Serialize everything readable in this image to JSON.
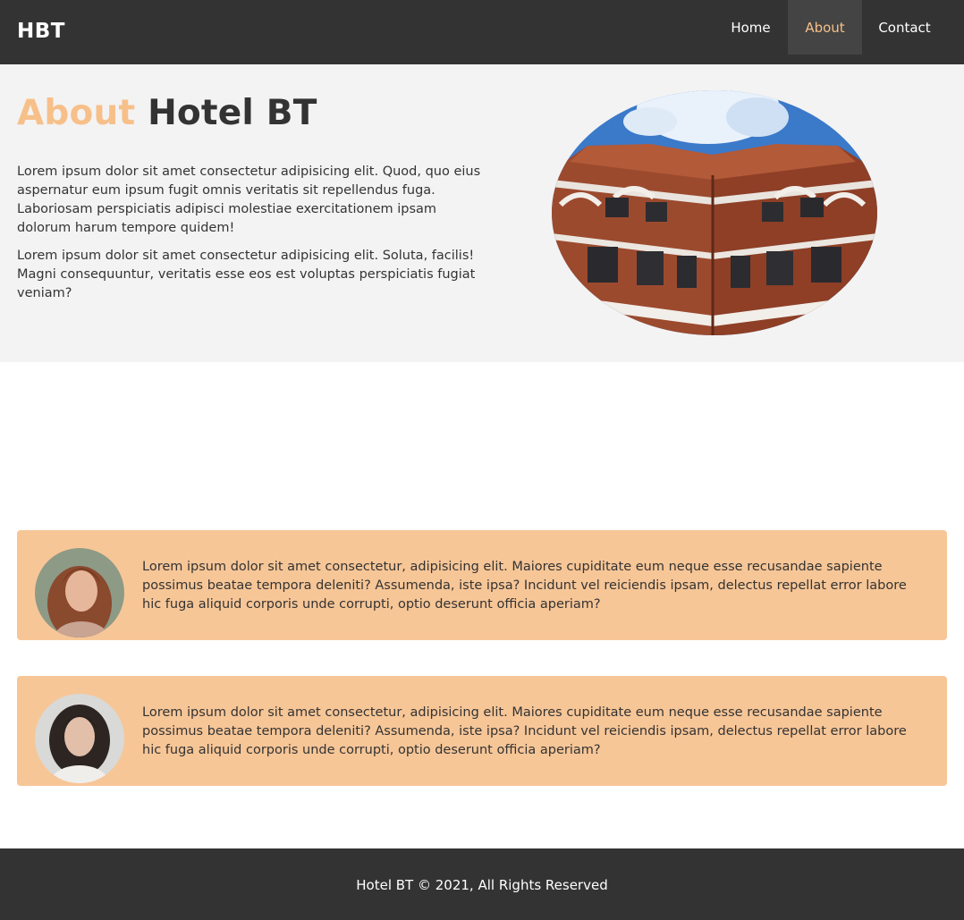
{
  "navbar": {
    "logo": "HBT",
    "links": [
      {
        "label": "Home",
        "active": false
      },
      {
        "label": "About",
        "active": true
      },
      {
        "label": "Contact",
        "active": false
      }
    ]
  },
  "about": {
    "title_accent": "About",
    "title_rest": "Hotel BT",
    "paragraphs": [
      "Lorem ipsum dolor sit amet consectetur adipisicing elit. Quod, quo eius aspernatur eum ipsum fugit omnis veritatis sit repellendus fuga. Laboriosam perspiciatis adipisci molestiae exercitationem ipsam dolorum harum tempore quidem!",
      "Lorem ipsum dolor sit amet consectetur adipisicing elit. Soluta, facilis! Magni consequuntur, veritatis esse eos est voluptas perspiciatis fugiat veniam?"
    ]
  },
  "testimonials": [
    {
      "text": "Lorem ipsum dolor sit amet consectetur, adipisicing elit. Maiores cupiditate eum neque esse recusandae sapiente possimus beatae tempora deleniti? Assumenda, iste ipsa? Incidunt vel reiciendis ipsam, delectus repellat error labore hic fuga aliquid corporis unde corrupti, optio deserunt officia aperiam?"
    },
    {
      "text": "Lorem ipsum dolor sit amet consectetur, adipisicing elit. Maiores cupiditate eum neque esse recusandae sapiente possimus beatae tempora deleniti? Assumenda, iste ipsa? Incidunt vel reiciendis ipsam, delectus repellat error labore hic fuga aliquid corporis unde corrupti, optio deserunt officia aperiam?"
    }
  ],
  "footer": {
    "text": "Hotel BT © 2021, All Rights Reserved"
  },
  "colors": {
    "dark": "#333333",
    "accent": "#f7c08a",
    "card": "#f7c697",
    "section_bg": "#f3f3f3"
  }
}
